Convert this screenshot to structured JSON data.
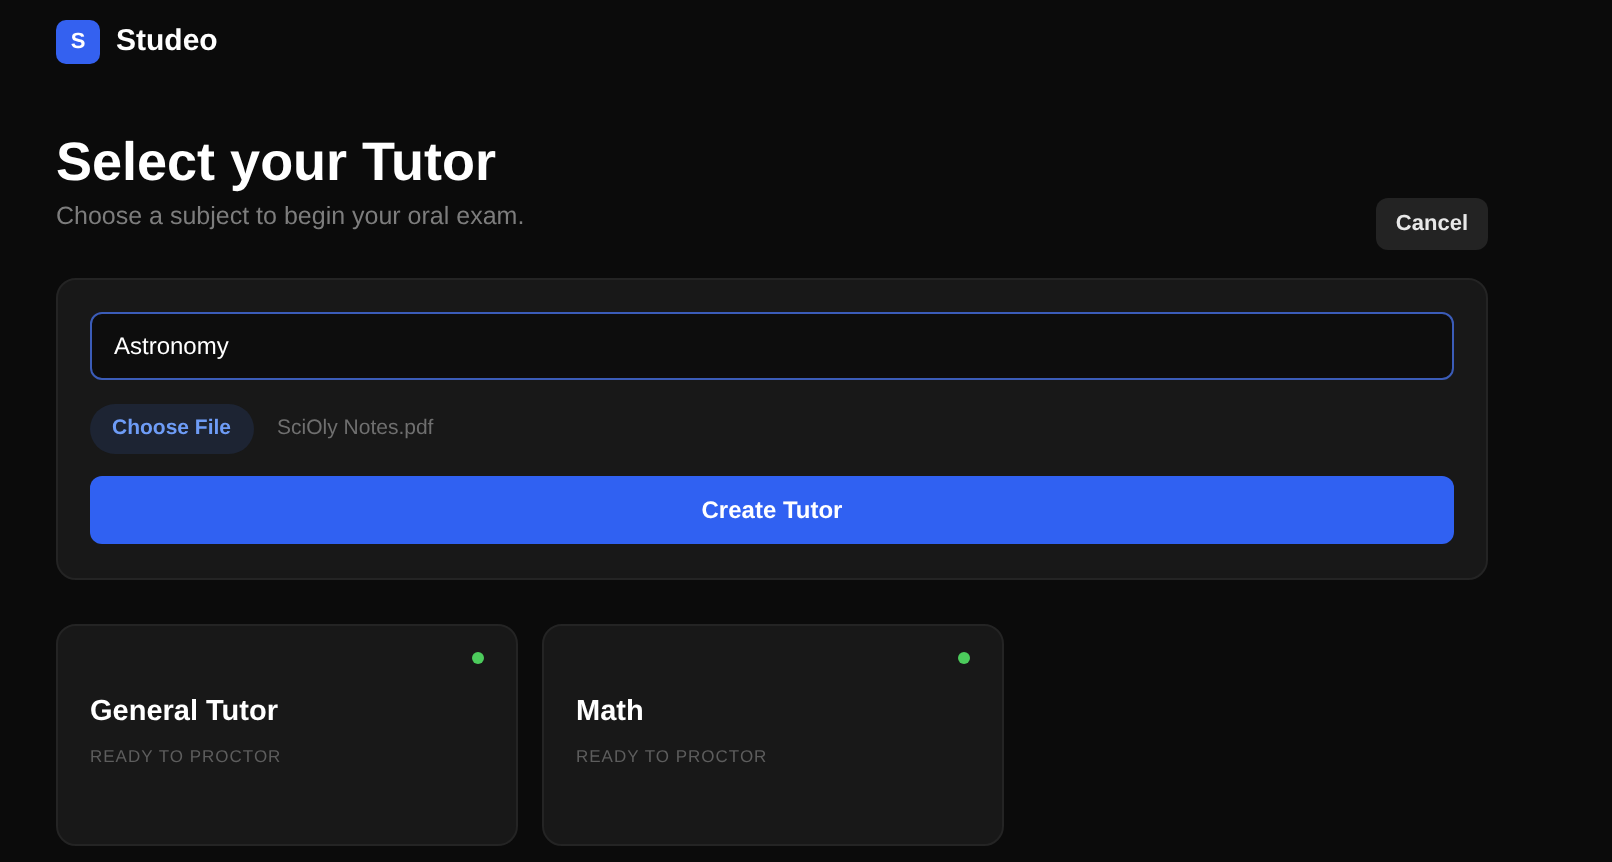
{
  "brand": {
    "logo_letter": "S",
    "name": "Studeo"
  },
  "header": {
    "title": "Select your Tutor",
    "subtitle": "Choose a subject to begin your oral exam.",
    "cancel_button": "Cancel"
  },
  "form": {
    "subject_field": {
      "value": "Astronomy"
    },
    "file_button": "Choose File",
    "file_name": "SciOly Notes.pdf",
    "submit_button": "Create Tutor"
  },
  "tutors": [
    {
      "name": "General Tutor",
      "status": "READY TO PROCTOR",
      "active": true
    },
    {
      "name": "Math",
      "status": "READY TO PROCTOR",
      "active": true
    }
  ]
}
